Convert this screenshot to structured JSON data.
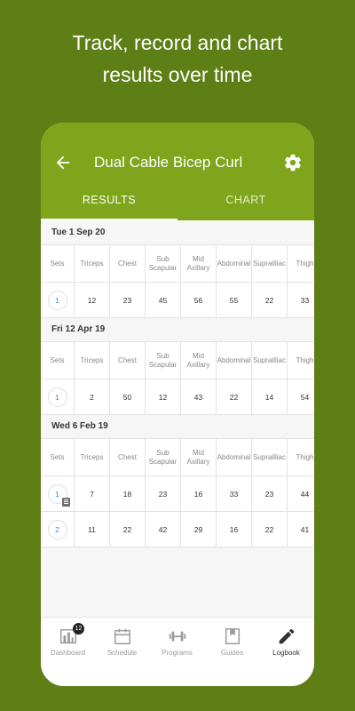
{
  "headline": {
    "line1": "Track, record and chart",
    "line2": "results over time"
  },
  "appbar": {
    "title": "Dual Cable Bicep Curl"
  },
  "tabs": [
    {
      "label": "RESULTS",
      "active": true
    },
    {
      "label": "CHART",
      "active": false
    }
  ],
  "table_headers": [
    "Sets",
    "Triceps",
    "Chest",
    "Sub\nScapular",
    "Mid\nAxillary",
    "Abdominal",
    "Suprailliac",
    "Thigh"
  ],
  "sessions": [
    {
      "date": "Tue 1 Sep 20",
      "rows": [
        {
          "set": "1",
          "values": [
            "12",
            "23",
            "45",
            "56",
            "55",
            "22",
            "33"
          ]
        }
      ]
    },
    {
      "date": "Fri 12 Apr 19",
      "rows": [
        {
          "set": "1",
          "values": [
            "2",
            "50",
            "12",
            "43",
            "22",
            "14",
            "54"
          ]
        }
      ]
    },
    {
      "date": "Wed 6 Feb 19",
      "rows": [
        {
          "set": "1",
          "values": [
            "7",
            "18",
            "23",
            "16",
            "33",
            "23",
            "44"
          ],
          "has_note": true
        },
        {
          "set": "2",
          "values": [
            "11",
            "22",
            "42",
            "29",
            "16",
            "22",
            "41"
          ]
        }
      ]
    }
  ],
  "bottom_nav": [
    {
      "label": "Dashboard",
      "icon": "dashboard-icon",
      "badge": "12"
    },
    {
      "label": "Schedule",
      "icon": "calendar-icon"
    },
    {
      "label": "Programs",
      "icon": "dumbbell-icon"
    },
    {
      "label": "Guides",
      "icon": "bookmark-icon"
    },
    {
      "label": "Logbook",
      "icon": "pencil-icon",
      "active": true
    }
  ],
  "colors": {
    "background": "#5e7e16",
    "appbar": "#7ea51b",
    "set_number": "#3a8fd6"
  }
}
